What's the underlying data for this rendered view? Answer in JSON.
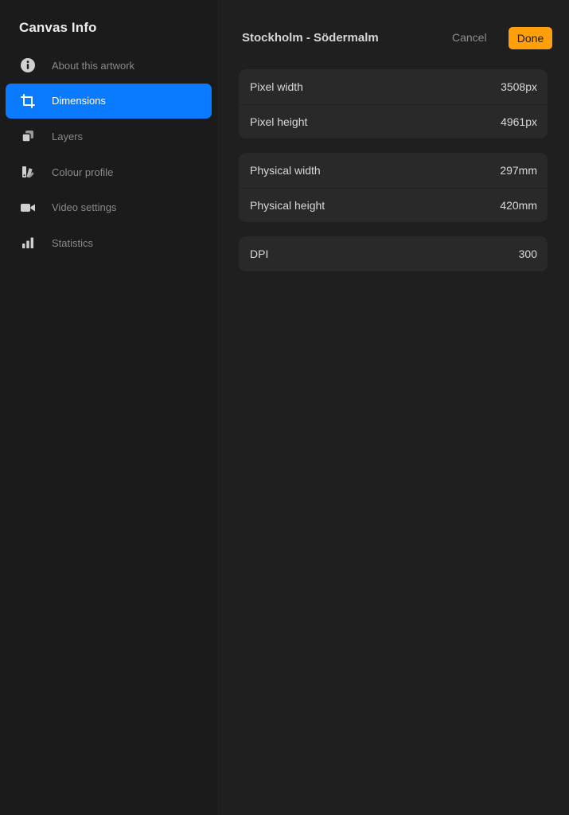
{
  "sidebar": {
    "title": "Canvas Info",
    "items": [
      {
        "label": "About this artwork",
        "icon": "info-circle-icon",
        "active": false
      },
      {
        "label": "Dimensions",
        "icon": "crop-icon",
        "active": true
      },
      {
        "label": "Layers",
        "icon": "layers-icon",
        "active": false
      },
      {
        "label": "Colour profile",
        "icon": "colour-swatch-icon",
        "active": false
      },
      {
        "label": "Video settings",
        "icon": "video-camera-icon",
        "active": false
      },
      {
        "label": "Statistics",
        "icon": "bar-chart-icon",
        "active": false
      }
    ]
  },
  "header": {
    "title": "Stockholm - Södermalm",
    "cancel_label": "Cancel",
    "done_label": "Done"
  },
  "dimensions": {
    "pixel": [
      {
        "label": "Pixel width",
        "value": "3508px"
      },
      {
        "label": "Pixel height",
        "value": "4961px"
      }
    ],
    "physical": [
      {
        "label": "Physical width",
        "value": "297mm"
      },
      {
        "label": "Physical height",
        "value": "420mm"
      }
    ],
    "dpi": [
      {
        "label": "DPI",
        "value": "300"
      }
    ]
  },
  "colors": {
    "accent_blue": "#0a7aff",
    "accent_orange": "#ff9f0a",
    "sidebar_bg": "#1b1b1b",
    "main_bg": "#1f1f1f",
    "group_bg": "#292929"
  }
}
